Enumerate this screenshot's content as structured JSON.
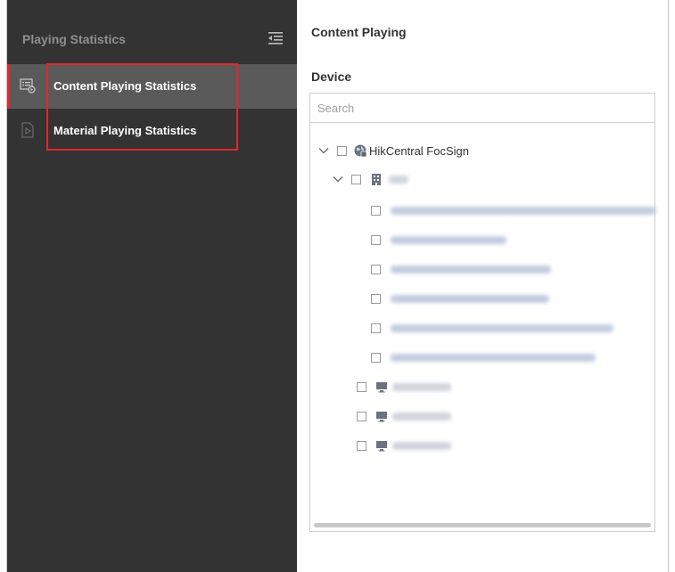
{
  "sidebar": {
    "title": "Playing Statistics",
    "items": [
      {
        "label": "Content Playing Statistics",
        "active": true
      },
      {
        "label": "Material Playing Statistics",
        "active": false
      }
    ]
  },
  "main": {
    "title": "Content Playing",
    "device_label": "Device",
    "search_placeholder": "Search",
    "tree": {
      "root_label": "HikCentral FocSign"
    }
  },
  "colors": {
    "sidebar_bg": "#333333",
    "active_item_bg": "#5a5a5a",
    "accent_red": "#e0282e"
  }
}
